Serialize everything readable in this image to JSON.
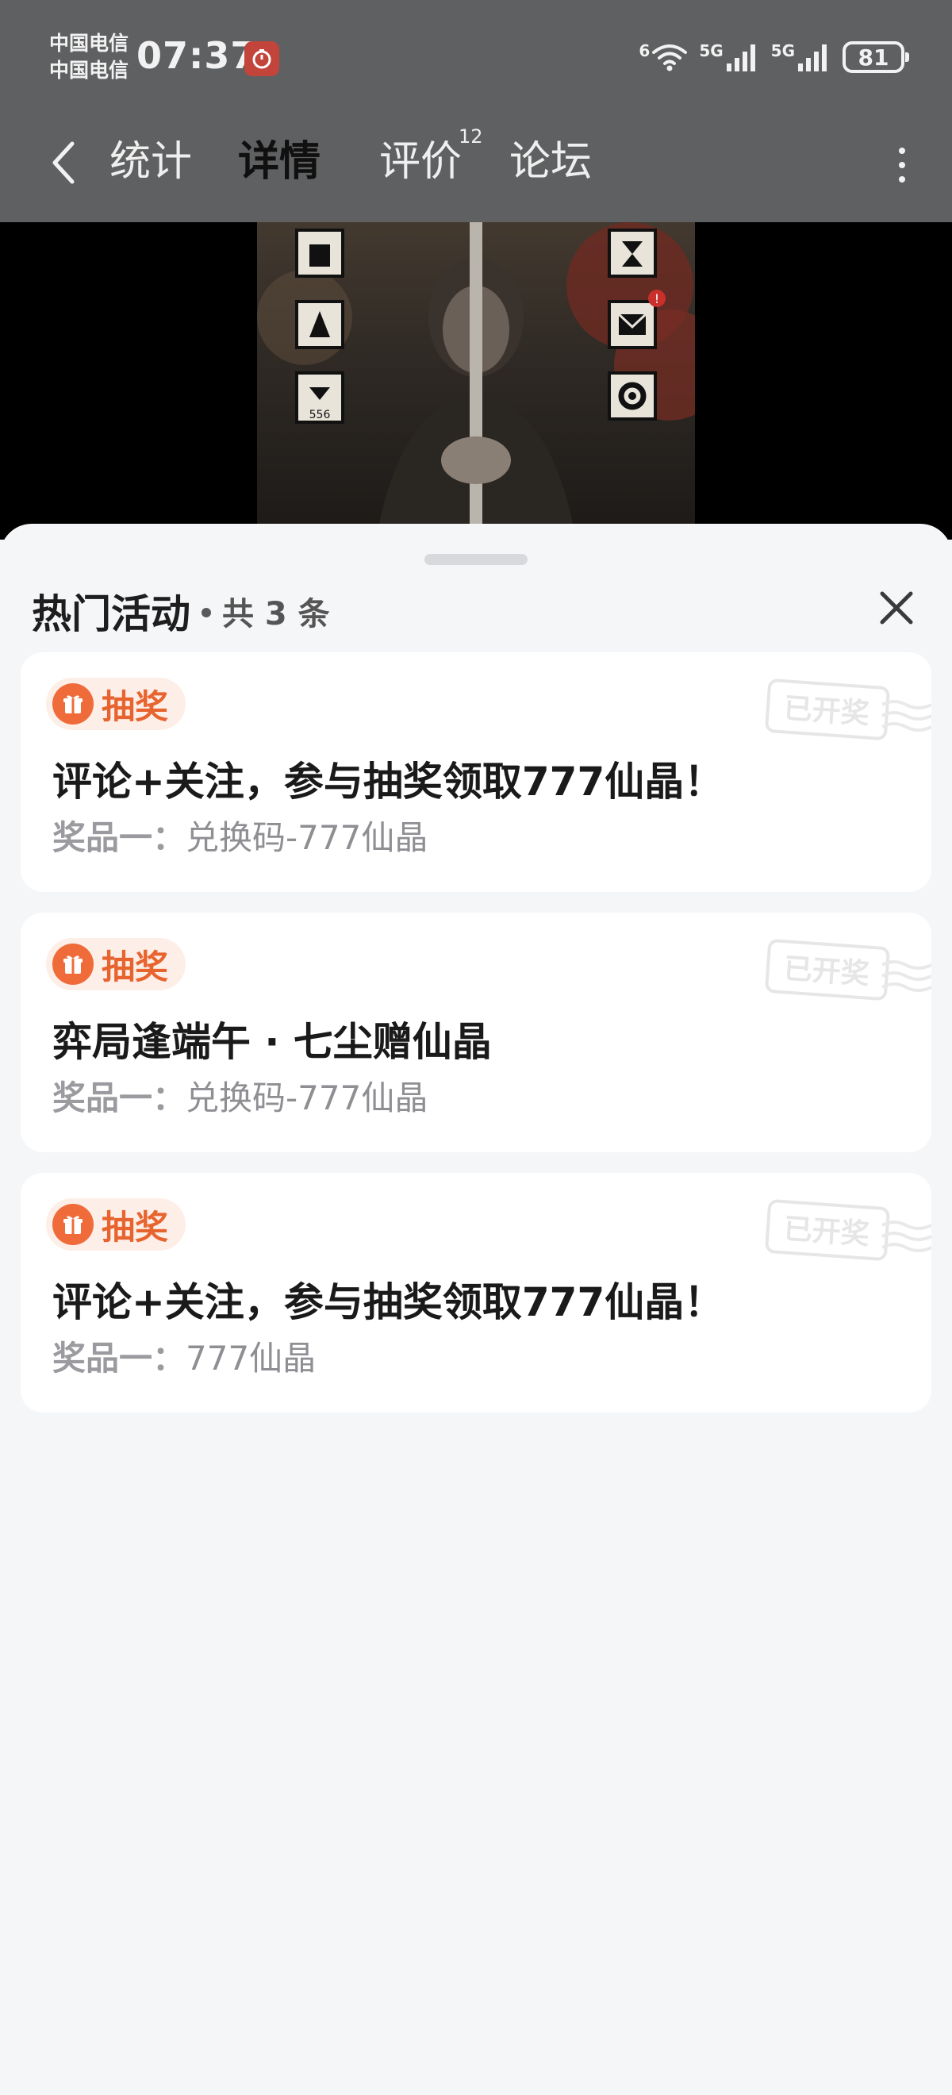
{
  "status_bar": {
    "carrier_1": "中国电信",
    "carrier_2": "中国电信",
    "time": "07:37",
    "wifi_label": "6",
    "sim1_label": "5G",
    "sim2_label": "5G",
    "battery": "81"
  },
  "nav": {
    "tabs": [
      {
        "label": "统计",
        "active": false
      },
      {
        "label": "详情",
        "active": true
      },
      {
        "label": "评价",
        "active": false,
        "badge": "12"
      },
      {
        "label": "论坛",
        "active": false
      }
    ],
    "active_tab_color": "#2f8a73"
  },
  "sheet": {
    "title": "热门活动",
    "count": "共 3 条"
  },
  "activities": [
    {
      "tag": "抽奖",
      "title": "评论+关注，参与抽奖领取777仙晶！",
      "prize_key": "奖品一：",
      "prize_value": "兑换码-777仙晶",
      "stamp": "已开奖"
    },
    {
      "tag": "抽奖",
      "title": "弈局逢端午 · 七尘赠仙晶",
      "prize_key": "奖品一：",
      "prize_value": "兑换码-777仙晶",
      "stamp": "已开奖"
    },
    {
      "tag": "抽奖",
      "title": "评论+关注，参与抽奖领取777仙晶！",
      "prize_key": "奖品一：",
      "prize_value": "777仙晶",
      "stamp": "已开奖"
    }
  ],
  "cover_overlay": {
    "badge_count": "556",
    "mail_alert": "!"
  },
  "colors": {
    "accent_orange": "#ef6b3a",
    "tag_background": "#fdeee7",
    "dim_overlay": "#5f6061"
  }
}
